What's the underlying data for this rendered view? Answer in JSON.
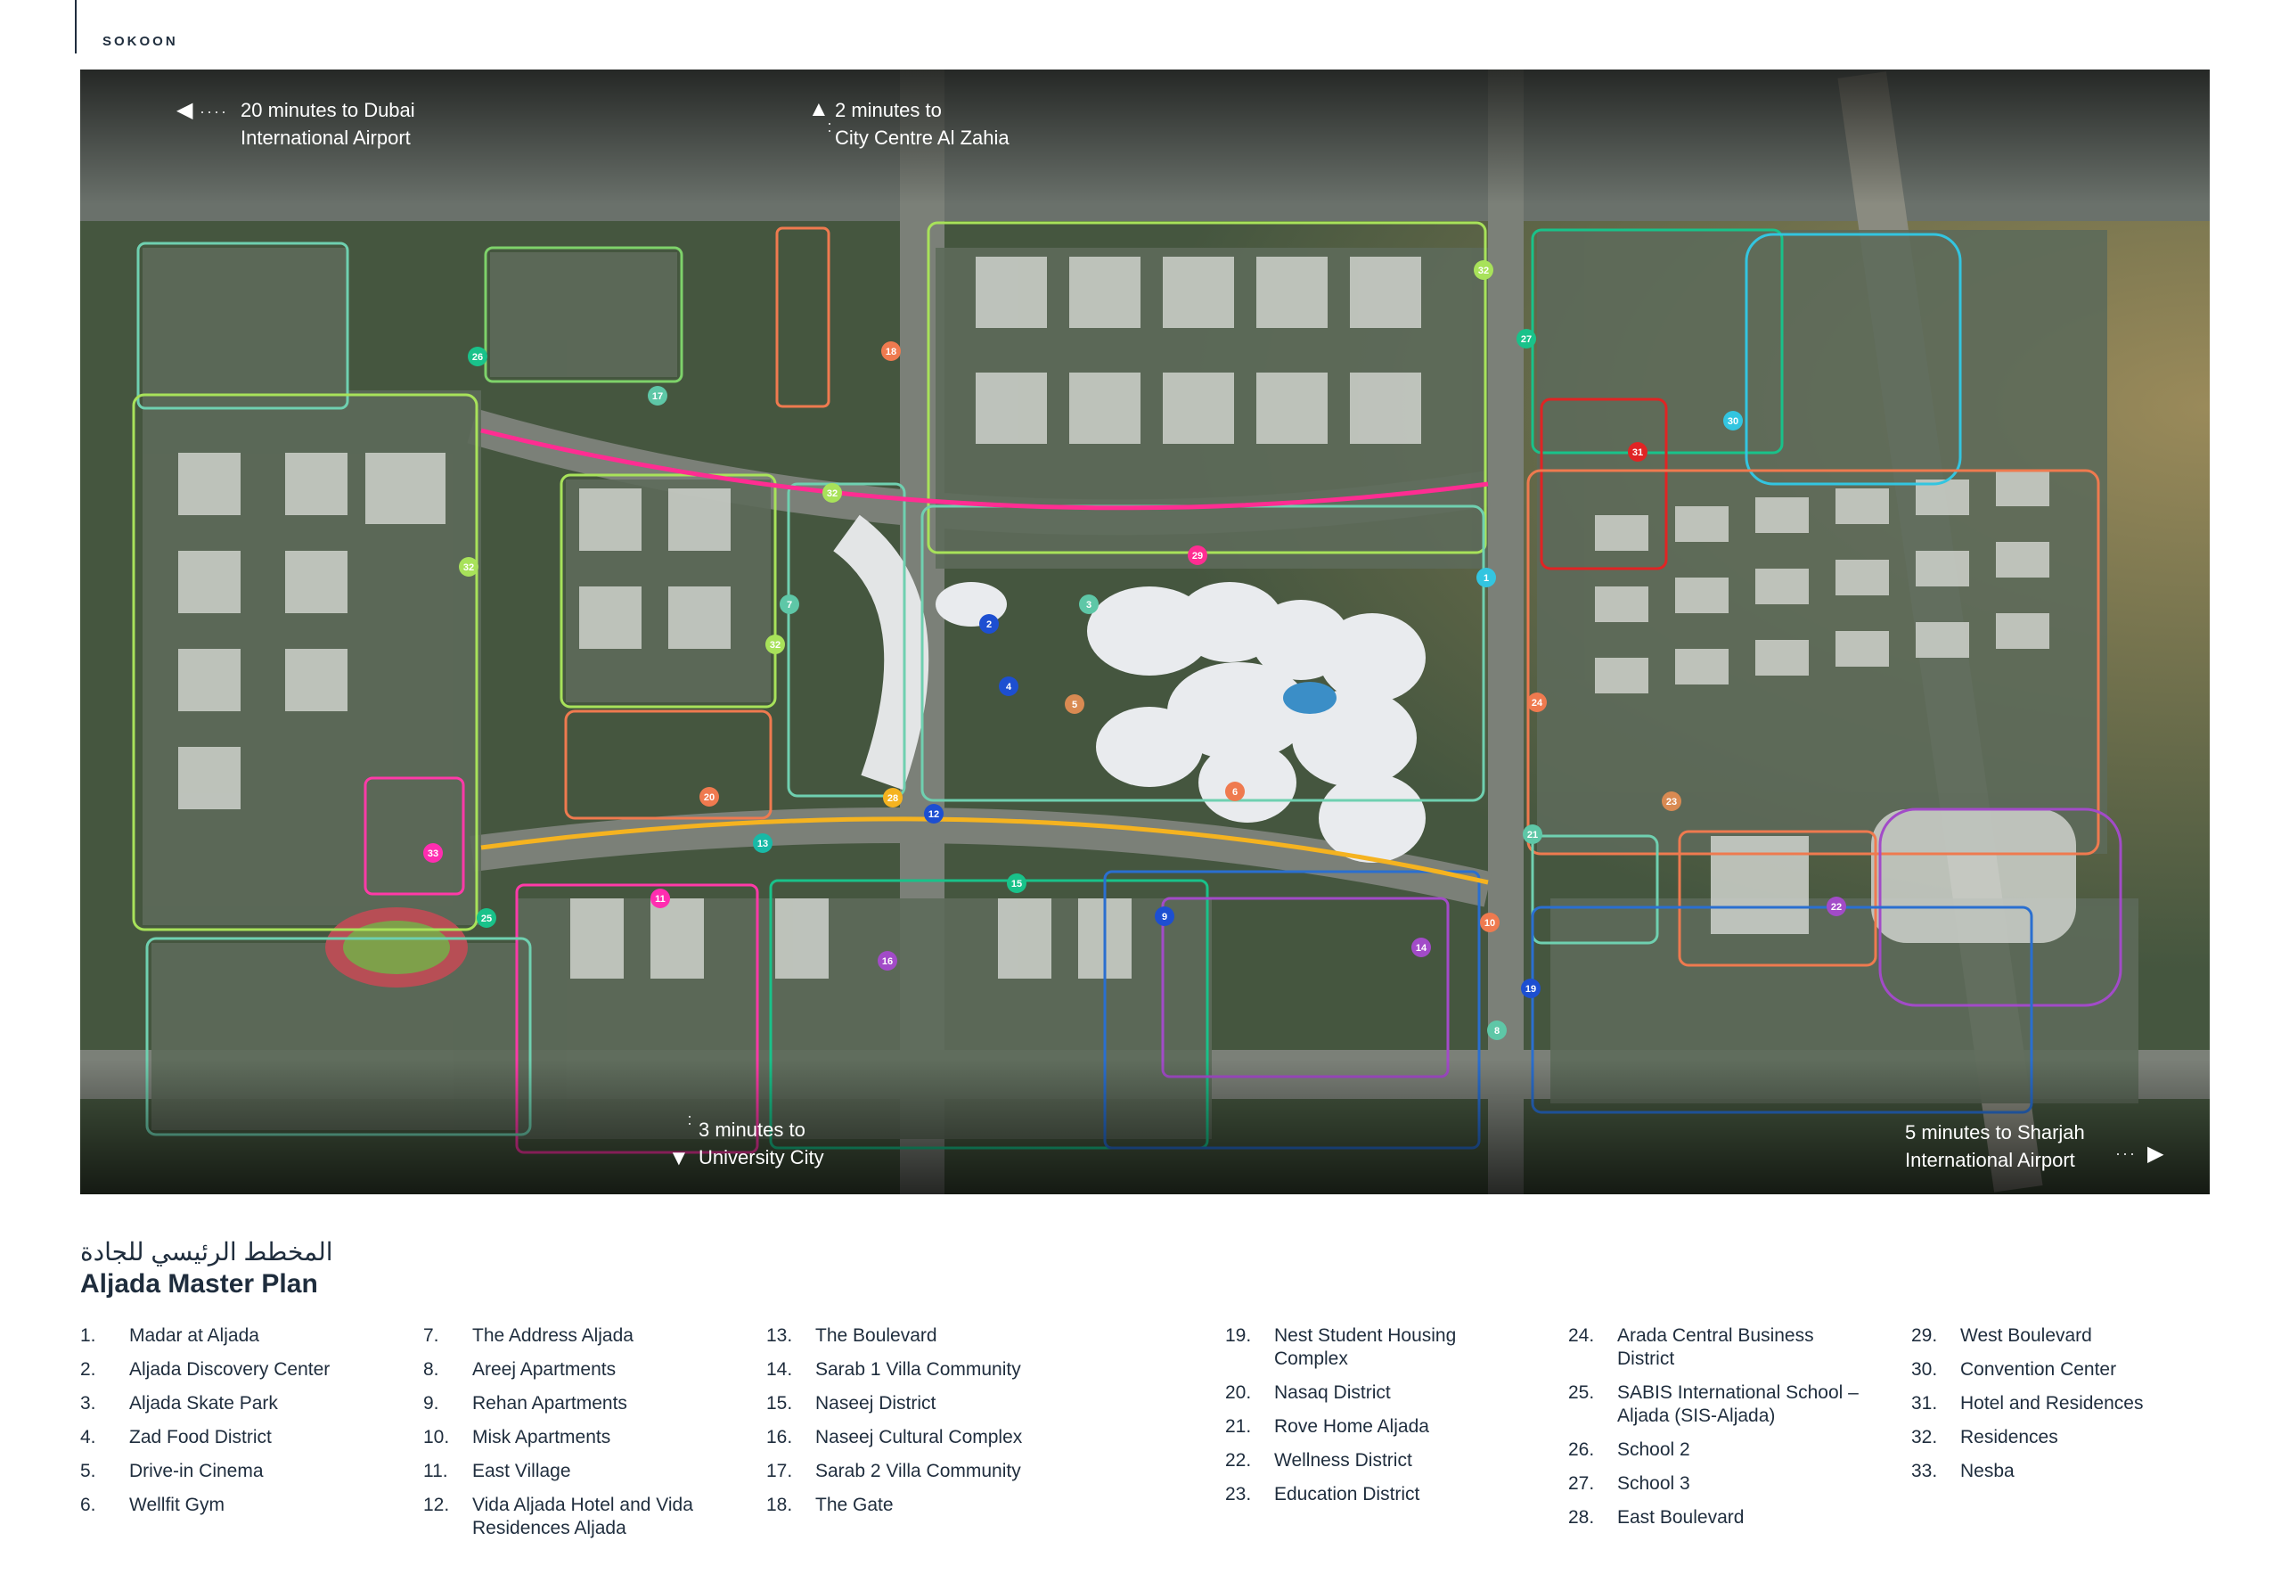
{
  "brand": "SOKOON",
  "map": {
    "callouts": [
      {
        "id": "airport-dubai",
        "line1": "20 minutes to Dubai",
        "line2": "International Airport",
        "icon": "arrow-left-icon"
      },
      {
        "id": "city-centre",
        "line1": "2 minutes to",
        "line2": "City Centre Al Zahia",
        "icon": "arrow-up-icon"
      },
      {
        "id": "university-city",
        "line1": "3 minutes to",
        "line2": "University City",
        "icon": "arrow-down-icon"
      },
      {
        "id": "airport-sharjah",
        "line1": "5 minutes to Sharjah",
        "line2": "International Airport",
        "icon": "arrow-right-icon"
      }
    ],
    "markers": [
      "1",
      "2",
      "3",
      "4",
      "5",
      "6",
      "7",
      "8",
      "9",
      "10",
      "11",
      "12",
      "13",
      "14",
      "15",
      "16",
      "17",
      "18",
      "19",
      "20",
      "21",
      "22",
      "23",
      "24",
      "25",
      "26",
      "27",
      "28",
      "29",
      "30",
      "31",
      "32",
      "32",
      "32",
      "32",
      "33"
    ]
  },
  "title": {
    "arabic": "المخطط الرئيسي للجادة",
    "english": "Aljada Master Plan"
  },
  "legend": [
    {
      "num": "1.",
      "label": "Madar at Aljada"
    },
    {
      "num": "2.",
      "label": "Aljada Discovery Center"
    },
    {
      "num": "3.",
      "label": "Aljada Skate Park"
    },
    {
      "num": "4.",
      "label": "Zad Food District"
    },
    {
      "num": "5.",
      "label": "Drive-in Cinema"
    },
    {
      "num": "6.",
      "label": "Wellfit Gym"
    },
    {
      "num": "7.",
      "label": "The Address Aljada"
    },
    {
      "num": "8.",
      "label": "Areej Apartments"
    },
    {
      "num": "9.",
      "label": "Rehan Apartments"
    },
    {
      "num": "10.",
      "label": "Misk Apartments"
    },
    {
      "num": "11.",
      "label": "East Village"
    },
    {
      "num": "12.",
      "label": "Vida Aljada Hotel and Vida Residences Aljada"
    },
    {
      "num": "13.",
      "label": "The Boulevard"
    },
    {
      "num": "14.",
      "label": "Sarab 1 Villa Community"
    },
    {
      "num": "15.",
      "label": "Naseej District"
    },
    {
      "num": "16.",
      "label": "Naseej Cultural Complex"
    },
    {
      "num": "17.",
      "label": "Sarab 2 Villa Community"
    },
    {
      "num": "18.",
      "label": "The Gate"
    },
    {
      "num": "19.",
      "label": "Nest Student Housing Complex"
    },
    {
      "num": "20.",
      "label": "Nasaq District"
    },
    {
      "num": "21.",
      "label": "Rove Home Aljada"
    },
    {
      "num": "22.",
      "label": "Wellness District"
    },
    {
      "num": "23.",
      "label": "Education District"
    },
    {
      "num": "24.",
      "label": "Arada Central Business District"
    },
    {
      "num": "25.",
      "label": "SABIS International School – Aljada (SIS-Aljada)"
    },
    {
      "num": "26.",
      "label": "School 2"
    },
    {
      "num": "27.",
      "label": "School 3"
    },
    {
      "num": "28.",
      "label": "East Boulevard"
    },
    {
      "num": "29.",
      "label": "West Boulevard"
    },
    {
      "num": "30.",
      "label": "Convention Center"
    },
    {
      "num": "31.",
      "label": "Hotel and Residences"
    },
    {
      "num": "32.",
      "label": "Residences"
    },
    {
      "num": "33.",
      "label": "Nesba"
    }
  ]
}
